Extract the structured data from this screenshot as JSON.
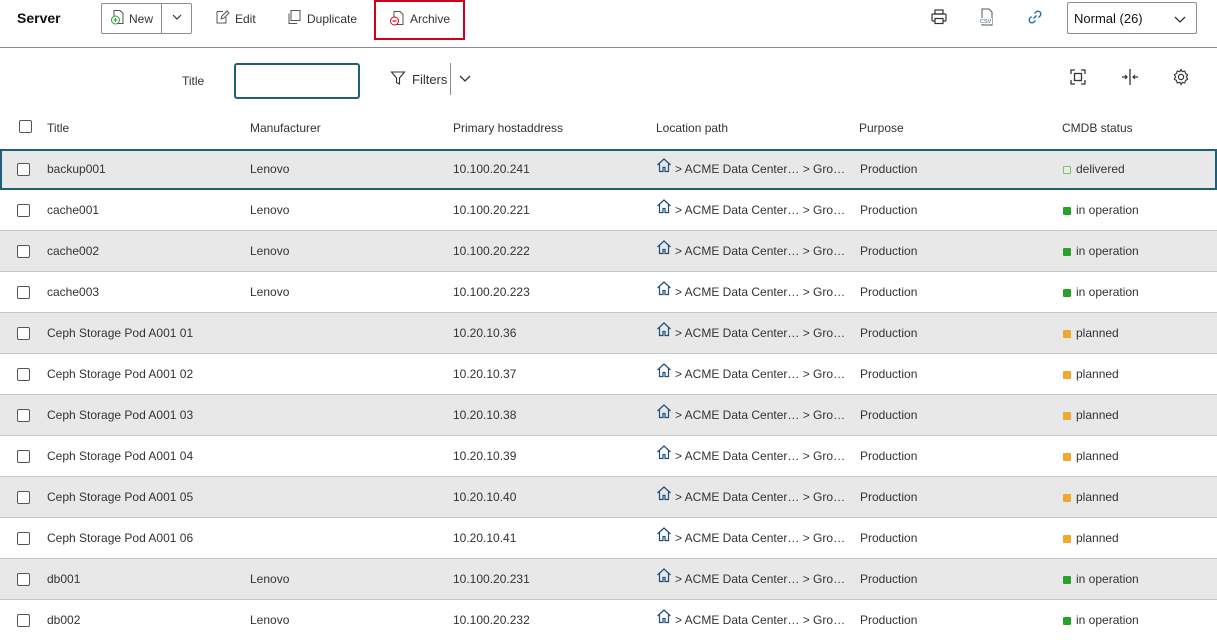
{
  "toolbar": {
    "title": "Server",
    "new_label": "New",
    "edit_label": "Edit",
    "duplicate_label": "Duplicate",
    "archive_label": "Archive",
    "print_icon": "printer-icon",
    "csv_icon": "csv-export-icon",
    "link_icon": "link-icon",
    "view_select_value": "Normal (26)"
  },
  "filterbar": {
    "title_label": "Title",
    "title_value": "",
    "filters_label": "Filters"
  },
  "table": {
    "headers": [
      "Title",
      "Manufacturer",
      "Primary hostaddress",
      "Location path",
      "Purpose",
      "CMDB status"
    ],
    "rows": [
      {
        "title": "backup001",
        "manufacturer": "Lenovo",
        "ip": "10.100.20.241",
        "location": "> ACME Data Center… > Gro…",
        "purpose": "Production",
        "status": "delivered",
        "status_color": "#7cc26b"
      },
      {
        "title": "cache001",
        "manufacturer": "Lenovo",
        "ip": "10.100.20.221",
        "location": "> ACME Data Center… > Gro…",
        "purpose": "Production",
        "status": "in operation",
        "status_color": "#2ca02c"
      },
      {
        "title": "cache002",
        "manufacturer": "Lenovo",
        "ip": "10.100.20.222",
        "location": "> ACME Data Center… > Gro…",
        "purpose": "Production",
        "status": "in operation",
        "status_color": "#2ca02c"
      },
      {
        "title": "cache003",
        "manufacturer": "Lenovo",
        "ip": "10.100.20.223",
        "location": "> ACME Data Center… > Gro…",
        "purpose": "Production",
        "status": "in operation",
        "status_color": "#2ca02c"
      },
      {
        "title": "Ceph Storage Pod A001 01",
        "manufacturer": "",
        "ip": "10.20.10.36",
        "location": "> ACME Data Center… > Gro…",
        "purpose": "Production",
        "status": "planned",
        "status_color": "#f0a830"
      },
      {
        "title": "Ceph Storage Pod A001 02",
        "manufacturer": "",
        "ip": "10.20.10.37",
        "location": "> ACME Data Center… > Gro…",
        "purpose": "Production",
        "status": "planned",
        "status_color": "#f0a830"
      },
      {
        "title": "Ceph Storage Pod A001 03",
        "manufacturer": "",
        "ip": "10.20.10.38",
        "location": "> ACME Data Center… > Gro…",
        "purpose": "Production",
        "status": "planned",
        "status_color": "#f0a830"
      },
      {
        "title": "Ceph Storage Pod A001 04",
        "manufacturer": "",
        "ip": "10.20.10.39",
        "location": "> ACME Data Center… > Gro…",
        "purpose": "Production",
        "status": "planned",
        "status_color": "#f0a830"
      },
      {
        "title": "Ceph Storage Pod A001 05",
        "manufacturer": "",
        "ip": "10.20.10.40",
        "location": "> ACME Data Center… > Gro…",
        "purpose": "Production",
        "status": "planned",
        "status_color": "#f0a830"
      },
      {
        "title": "Ceph Storage Pod A001 06",
        "manufacturer": "",
        "ip": "10.20.10.41",
        "location": "> ACME Data Center… > Gro…",
        "purpose": "Production",
        "status": "planned",
        "status_color": "#f0a830"
      },
      {
        "title": "db001",
        "manufacturer": "Lenovo",
        "ip": "10.100.20.231",
        "location": "> ACME Data Center… > Gro…",
        "purpose": "Production",
        "status": "in operation",
        "status_color": "#2ca02c"
      },
      {
        "title": "db002",
        "manufacturer": "Lenovo",
        "ip": "10.100.20.232",
        "location": "> ACME Data Center… > Gro…",
        "purpose": "Production",
        "status": "in operation",
        "status_color": "#2ca02c"
      }
    ]
  },
  "colors": {
    "accent": "#1f5f7a",
    "highlight_border": "#d0021b",
    "row_alt": "#e8e8e8"
  }
}
